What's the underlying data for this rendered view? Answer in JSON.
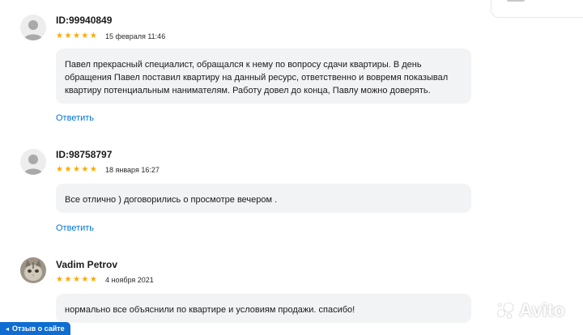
{
  "reviews": [
    {
      "author": "ID:99940849",
      "rating": 5,
      "date": "15 февраля 11:46",
      "text": "Павел прекрасный специалист, обращался к нему по вопросу сдачи квартиры. В день обращения Павел поставил квартиру на данный ресурс, ответственно и вовремя показывал квартиру потенциальным нанимателям. Работу довел до конца, Павлу можно доверять.",
      "reply_label": "Ответить",
      "avatar": "default-user-icon"
    },
    {
      "author": "ID:98758797",
      "rating": 5,
      "date": "18 января 16:27",
      "text": "Все отлично ) договорились о просмотре вечером .",
      "reply_label": "Ответить",
      "avatar": "default-user-icon"
    },
    {
      "author": "Vadim Petrov",
      "rating": 5,
      "date": "4 ноября 2021",
      "text": "нормально все объяснили по квартире и условиям продажи. спасибо!",
      "avatar": "cat-photo"
    }
  ],
  "feedback_button": {
    "label": "Отзыв о сайте"
  },
  "watermark": {
    "label": "Avito"
  },
  "colors": {
    "star": "#ffa800",
    "link": "#0073d9",
    "bubble": "#f2f3f5",
    "button": "#0f6dd1"
  }
}
